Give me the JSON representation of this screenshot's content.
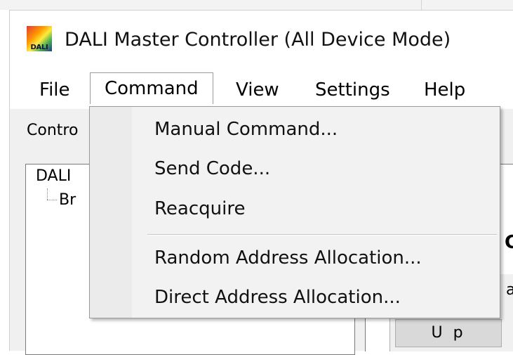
{
  "window": {
    "title": "DALI Master Controller (All Device Mode)",
    "icon_text": "DALI"
  },
  "menubar": {
    "items": [
      {
        "label": "File"
      },
      {
        "label": "Command"
      },
      {
        "label": "View"
      },
      {
        "label": "Settings"
      },
      {
        "label": "Help"
      }
    ]
  },
  "tabs": {
    "active_label": "Contro"
  },
  "tree": {
    "root": "DALI",
    "child": "Br"
  },
  "right_panel": {
    "heading": "C",
    "small_text": "a",
    "up_button": "U p"
  },
  "dropdown": {
    "items": [
      {
        "label": "Manual Command..."
      },
      {
        "label": "Send Code..."
      },
      {
        "label": "Reacquire"
      },
      {
        "label": "Random Address Allocation..."
      },
      {
        "label": "Direct Address Allocation..."
      }
    ]
  },
  "colors": {
    "menu_background": "#f2f2f2",
    "menu_border": "#9a9a9a",
    "window_background": "#f0f0f0"
  }
}
